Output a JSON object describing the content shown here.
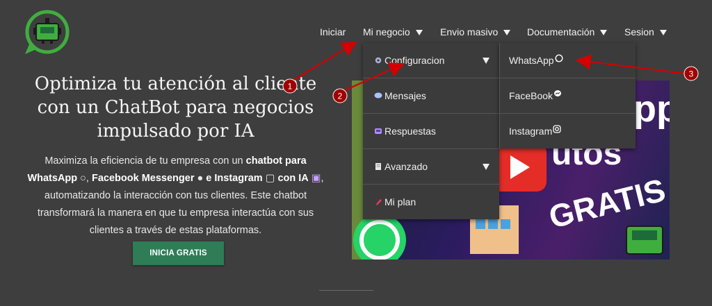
{
  "colors": {
    "background": "#3e3e3e",
    "menu_bg": "#3b3b3b",
    "cta_bg": "#2e7d57",
    "annotation": "#d40000",
    "logo_green": "#3fae3f"
  },
  "nav": {
    "items": [
      {
        "label": "Iniciar",
        "has_caret": false
      },
      {
        "label": "Mi negocio",
        "has_caret": true
      },
      {
        "label": "Envio masivo",
        "has_caret": true
      },
      {
        "label": "Documentación",
        "has_caret": true
      },
      {
        "label": "Sesion",
        "has_caret": true
      }
    ]
  },
  "hero": {
    "title": "Optimiza tu atención al cliente con un ChatBot para negocios impulsado por IA",
    "text_1": "Maximiza la eficiencia de tu empresa con un ",
    "bold_1": "chatbot para WhatsApp",
    "bold_2": "Facebook Messenger",
    "bold_3": "e Instagram",
    "bold_4": "con IA",
    "text_2": ", automatizando la interacción con tus clientes. Este chatbot transformará la manera en que tu empresa interactúa con sus clientes a través de estas plataformas.",
    "cta_label": "INICIA GRATIS"
  },
  "submenu": {
    "items": [
      {
        "label": "Configuracion",
        "icon": "gear-icon",
        "has_arrow": true
      },
      {
        "label": "Mensajes",
        "icon": "chat-bubble-icon",
        "has_arrow": false
      },
      {
        "label": "Respuestas",
        "icon": "robot-icon",
        "has_arrow": false
      },
      {
        "label": "Avanzado",
        "icon": "document-icon",
        "has_arrow": true
      },
      {
        "label": "Mi plan",
        "icon": "pin-icon",
        "has_arrow": false
      }
    ]
  },
  "social_menu": {
    "items": [
      {
        "label": "WhatsApp",
        "icon": "whatsapp-icon"
      },
      {
        "label": "FaceBook",
        "icon": "messenger-icon"
      },
      {
        "label": "Instagram",
        "icon": "instagram-icon"
      }
    ]
  },
  "promo": {
    "text_top": "pp",
    "text_mid": "utos",
    "text_bottom": "GRATIS"
  },
  "annotations": {
    "badges": [
      "1",
      "2",
      "3"
    ]
  }
}
